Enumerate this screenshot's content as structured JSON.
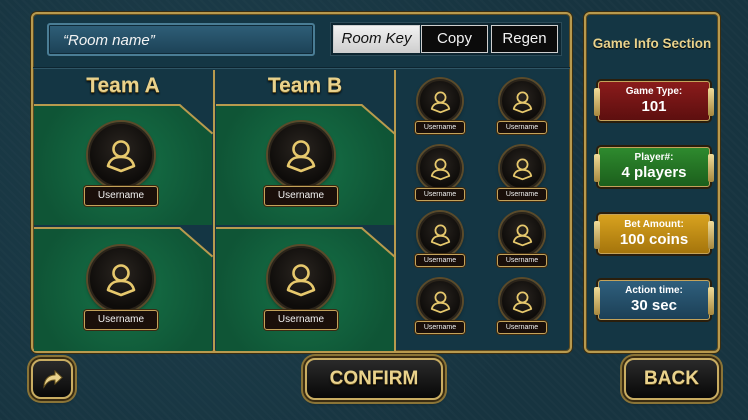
{
  "room": {
    "name_value": "“Room name”",
    "room_key_label": "Room Key",
    "copy_label": "Copy",
    "regen_label": "Regen"
  },
  "teams": [
    {
      "title": "Team A",
      "slots": [
        {
          "username": "Username"
        },
        {
          "username": "Username"
        }
      ]
    },
    {
      "title": "Team B",
      "slots": [
        {
          "username": "Username"
        },
        {
          "username": "Username"
        }
      ]
    }
  ],
  "lobby": {
    "players": [
      {
        "username": "Username"
      },
      {
        "username": "Username"
      },
      {
        "username": "Username"
      },
      {
        "username": "Username"
      },
      {
        "username": "Username"
      },
      {
        "username": "Username"
      },
      {
        "username": "Username"
      },
      {
        "username": "Username"
      }
    ]
  },
  "info": {
    "title": "Game Info Section",
    "game_type": {
      "label": "Game Type:",
      "value": "101"
    },
    "players": {
      "label": "Player#:",
      "value": "4 players"
    },
    "bet": {
      "label": "Bet Amount:",
      "value": "100 coins"
    },
    "action_time": {
      "label": "Action time:",
      "value": "30 sec"
    }
  },
  "buttons": {
    "confirm_label": "CONFIRM",
    "back_label": "BACK",
    "share_icon": "share-arrow-icon"
  },
  "colors": {
    "gold": "#b89a4e",
    "felt_green": "#115a3b",
    "background": "#173440",
    "game_type_card": "#8a1b1b",
    "players_card": "#2e8a2e",
    "bet_card": "#d8a21f",
    "action_card": "#2f5f7d"
  }
}
